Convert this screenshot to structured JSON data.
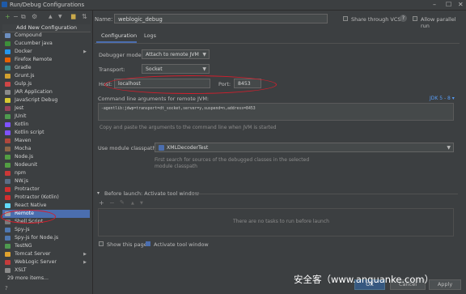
{
  "window": {
    "title": "Run/Debug Configurations",
    "minimize": "–",
    "maximize": "☐",
    "close": "✕"
  },
  "toolbar": {
    "add": "+",
    "remove": "−",
    "copy": "⧉",
    "settings": "⚙",
    "up": "▲",
    "down": "▼",
    "folder": "▆",
    "sort": "⇅"
  },
  "popup": {
    "header": "Add New Configuration",
    "items": [
      {
        "label": "Compound",
        "icon_color": "#6c8ebf",
        "arrow": ""
      },
      {
        "label": "Cucumber java",
        "icon_color": "#3d8f3a",
        "arrow": ""
      },
      {
        "label": "Docker",
        "icon_color": "#2496ed",
        "arrow": "▶"
      },
      {
        "label": "Firefox Remote",
        "icon_color": "#e66000",
        "arrow": ""
      },
      {
        "label": "Gradle",
        "icon_color": "#3d8d8f",
        "arrow": ""
      },
      {
        "label": "Grunt.js",
        "icon_color": "#d2a12f",
        "arrow": ""
      },
      {
        "label": "Gulp.js",
        "icon_color": "#cf4646",
        "arrow": ""
      },
      {
        "label": "JAR Application",
        "icon_color": "#8a8a8a",
        "arrow": ""
      },
      {
        "label": "JavaScript Debug",
        "icon_color": "#d6c832",
        "arrow": ""
      },
      {
        "label": "Jest",
        "icon_color": "#99425b",
        "arrow": ""
      },
      {
        "label": "JUnit",
        "icon_color": "#4f9a4f",
        "arrow": ""
      },
      {
        "label": "Kotlin",
        "icon_color": "#7f52ff",
        "arrow": ""
      },
      {
        "label": "Kotlin script",
        "icon_color": "#7f52ff",
        "arrow": ""
      },
      {
        "label": "Maven",
        "icon_color": "#b0473c",
        "arrow": ""
      },
      {
        "label": "Mocha",
        "icon_color": "#8d6748",
        "arrow": ""
      },
      {
        "label": "Node.js",
        "icon_color": "#539e43",
        "arrow": ""
      },
      {
        "label": "Nodeunit",
        "icon_color": "#539e43",
        "arrow": ""
      },
      {
        "label": "npm",
        "icon_color": "#cb3837",
        "arrow": ""
      },
      {
        "label": "NW.js",
        "icon_color": "#5b6e86",
        "arrow": ""
      },
      {
        "label": "Protractor",
        "icon_color": "#d12f2f",
        "arrow": ""
      },
      {
        "label": "Protractor (Kotlin)",
        "icon_color": "#d12f2f",
        "arrow": ""
      },
      {
        "label": "React Native",
        "icon_color": "#61dafb",
        "arrow": ""
      },
      {
        "label": "Remote",
        "icon_color": "#9aa7b0",
        "arrow": ""
      },
      {
        "label": "Shell Script",
        "icon_color": "#7a7a7a",
        "arrow": ""
      },
      {
        "label": "Spy-js",
        "icon_color": "#4f78b0",
        "arrow": ""
      },
      {
        "label": "Spy-js for Node.js",
        "icon_color": "#4f78b0",
        "arrow": ""
      },
      {
        "label": "TestNG",
        "icon_color": "#4f9a4f",
        "arrow": ""
      },
      {
        "label": "Tomcat Server",
        "icon_color": "#e0a32e",
        "arrow": "▶"
      },
      {
        "label": "WebLogic Server",
        "icon_color": "#c43b3b",
        "arrow": "▶"
      },
      {
        "label": "XSLT",
        "icon_color": "#8a8a8a",
        "arrow": ""
      },
      {
        "label": "29 more items...",
        "icon_color": "",
        "arrow": ""
      }
    ],
    "selected_index": 22
  },
  "name_row": {
    "label": "Name:",
    "value": "weblogic_debug",
    "share_label": "Share through VCS",
    "help": "?",
    "parallel_label": "Allow parallel run"
  },
  "tabs": [
    {
      "label": "Configuration"
    },
    {
      "label": "Logs"
    }
  ],
  "debugger": {
    "label": "Debugger mode:",
    "value": "Attach to remote JVM"
  },
  "transport": {
    "label": "Transport:",
    "value": "Socket"
  },
  "host": {
    "label": "Host:",
    "value": "localhost"
  },
  "port": {
    "label": "Port:",
    "value": "8453"
  },
  "cmdline": {
    "label": "Command line arguments for remote JVM:",
    "jdk": "JDK 5 - 8 ▾",
    "value": "-agentlib:jdwp=transport=dt_socket,server=y,suspend=n,address=8453",
    "hint": "Copy and paste the arguments to the command line when JVM is started"
  },
  "classpath": {
    "label": "Use module classpath:",
    "value": "XMLDecoderTest",
    "hint_line1": "First search for sources of the debugged classes in the selected",
    "hint_line2": "module classpath"
  },
  "before_launch": {
    "title": "Before launch: Activate tool window",
    "toggle": "▾",
    "add": "+",
    "remove": "−",
    "edit": "✎",
    "up": "▲",
    "down": "▼",
    "empty": "There are no tasks to run before launch"
  },
  "bottom_checks": {
    "show_page": "Show this page",
    "activate": "Activate tool window"
  },
  "buttons": {
    "ok": "OK",
    "cancel": "Cancel",
    "apply": "Apply"
  },
  "help_icon": "?",
  "watermark": "安全客（www.anquanke.com）",
  "colors": {
    "accent": "#4b6eaf",
    "annotation": "#d41e2c",
    "background": "#3c3f41"
  }
}
